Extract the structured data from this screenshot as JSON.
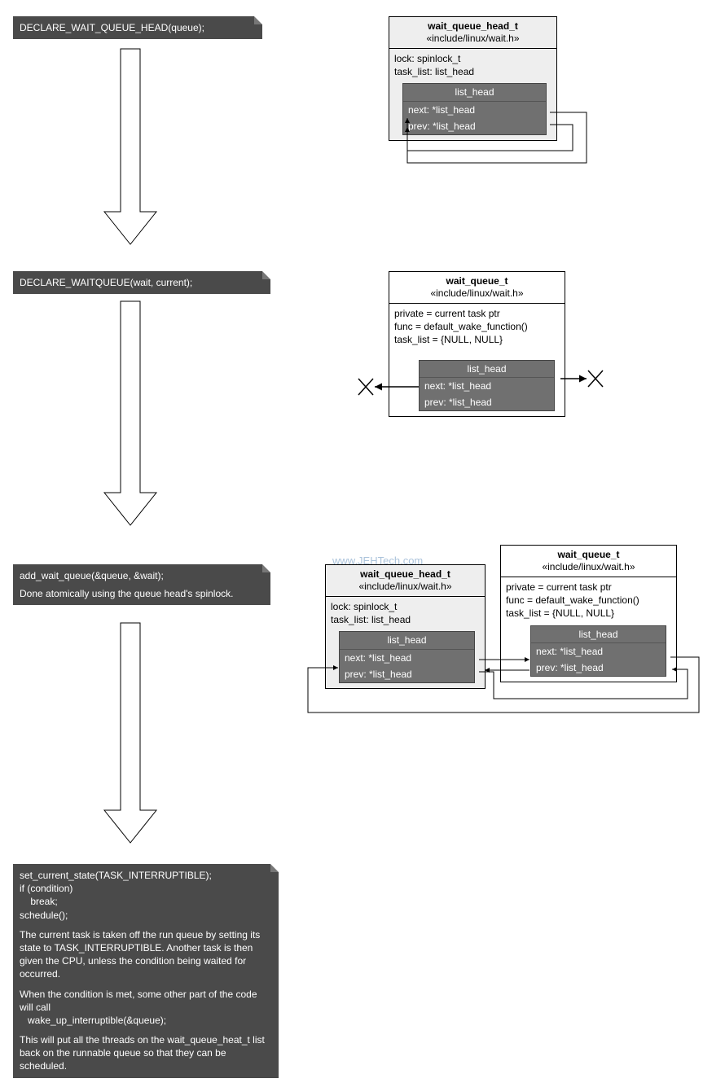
{
  "watermark": "www.JEHTech.com",
  "codebox1": {
    "line1": "DECLARE_WAIT_QUEUE_HEAD(queue);"
  },
  "codebox2": {
    "line1": "DECLARE_WAITQUEUE(wait, current);"
  },
  "codebox3": {
    "line1": "add_wait_queue(&queue, &wait);",
    "line2": "Done atomically using the queue head's spinlock."
  },
  "codebox4": {
    "line1": "set_current_state(TASK_INTERRUPTIBLE);",
    "line2": "if (condition)",
    "line3": "    break;",
    "line4": "schedule();",
    "p1": "The current task is taken off the run queue by setting its state to TASK_INTERRUPTIBLE. Another task is then given the CPU, unless the condition being waited for occurred.",
    "p2a": "When the condition is met, some other part of the code will call",
    "p2b": "   wake_up_interruptible(&queue);",
    "p3": "This will put all the threads on the wait_queue_heat_t list back on the runnable queue so that they can be scheduled."
  },
  "struct_head": {
    "title": "wait_queue_head_t",
    "subtitle": "«include/linux/wait.h»",
    "field1": "lock: spinlock_t",
    "field2": "task_list: list_head"
  },
  "struct_wq": {
    "title": "wait_queue_t",
    "subtitle": "«include/linux/wait.h»",
    "field1": "private = current task ptr",
    "field2": "func = default_wake_function()",
    "field3": "task_list = {NULL, NULL}"
  },
  "listhead": {
    "title": "list_head",
    "next": "next: *list_head",
    "prev": "prev: *list_head"
  }
}
